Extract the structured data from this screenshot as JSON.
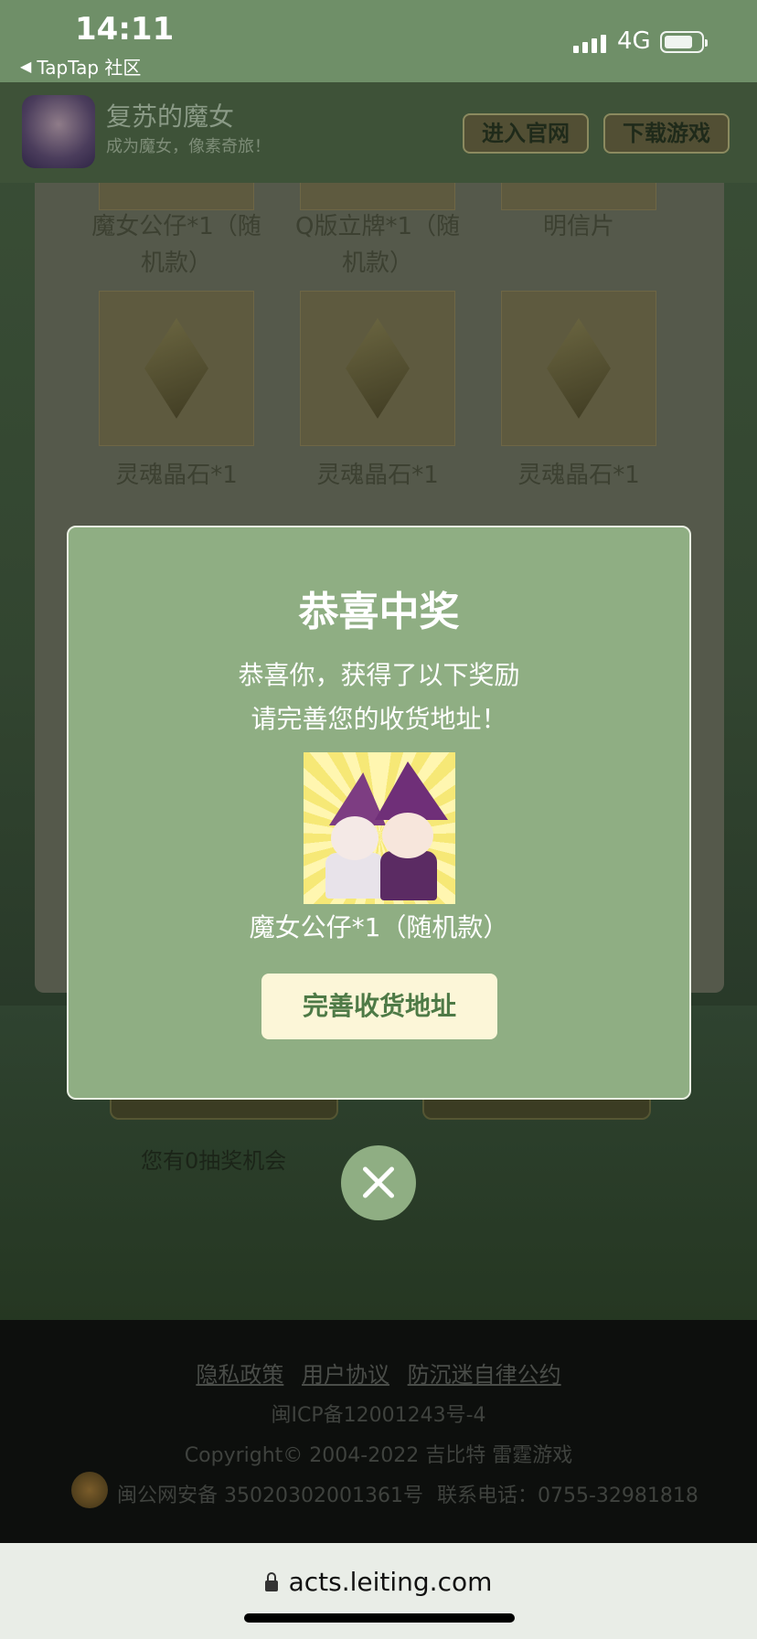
{
  "status_bar": {
    "time": "14:11",
    "back_app": "TapTap 社区",
    "network": "4G"
  },
  "app_header": {
    "name": "复苏的魔女",
    "slogan": "成为魔女，像素奇旅！",
    "btn_official": "进入官网",
    "btn_download": "下载游戏"
  },
  "prize_list": {
    "row1": [
      "魔女公仔*1（随机款）",
      "Q版立牌*1（随机款）",
      "明信片"
    ],
    "row2": [
      "灵魂晶石*1",
      "灵魂晶石*1",
      "灵魂晶石*1"
    ]
  },
  "draw": {
    "chances": "您有0抽奖机会"
  },
  "footer": {
    "links": [
      "隐私政策",
      "用户协议",
      "防沉迷自律公约"
    ],
    "icp": "闽ICP备12001243号-4",
    "copyright": "Copyright© 2004-2022 吉比特 雷霆游戏",
    "police": "闽公网安备 35020302001361号",
    "phone": "联系电话：0755-32981818"
  },
  "modal": {
    "title": "恭喜中奖",
    "line1": "恭喜你，获得了以下奖励",
    "line2": "请完善您的收货地址！",
    "prize_name": "魔女公仔*1（随机款）",
    "address_button": "完善收货地址"
  },
  "browser": {
    "url": "acts.leiting.com"
  },
  "icons": {
    "close": "close-icon",
    "lock": "lock-icon",
    "back": "back-arrow-icon",
    "signal": "signal-icon",
    "battery": "battery-icon"
  }
}
